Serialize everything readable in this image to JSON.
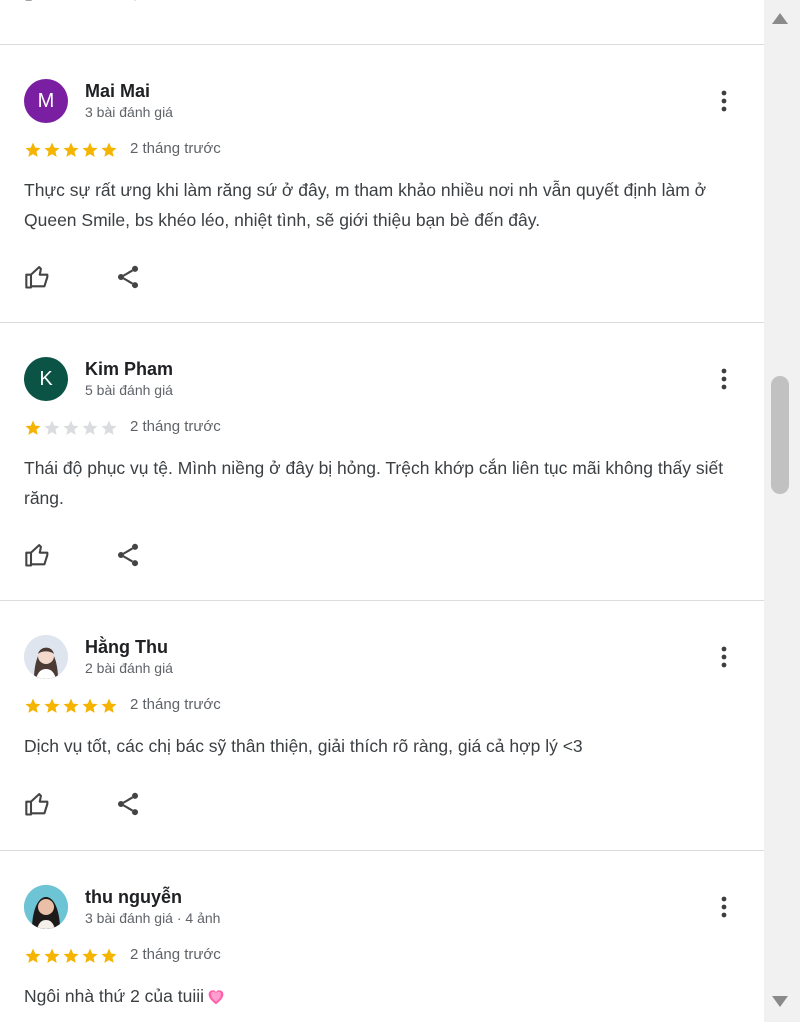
{
  "colors": {
    "star_filled": "#f4b400",
    "star_empty": "#dadce0",
    "divider": "#dadce0"
  },
  "reviews": [
    {
      "initial": "M",
      "avatar_color": "#7b1fa2",
      "name": "Mai Mai",
      "meta": "3 bài đánh giá",
      "rating": 5,
      "time": "2 tháng trước",
      "text": "Thực sự rất ưng khi làm răng sứ ở đây, m tham khảo nhiều nơi nh vẫn quyết định làm ở Queen Smile, bs khéo léo, nhiệt tình, sẽ giới thiệu bạn bè đến đây."
    },
    {
      "initial": "K",
      "avatar_color": "#0b5345",
      "name": "Kim Pham",
      "meta": "5 bài đánh giá",
      "rating": 1,
      "time": "2 tháng trước",
      "text": "Thái độ phục vụ tệ. Mình niềng ở đây bị hỏng. Trệch khớp cắn liên tục mãi không thấy siết răng."
    },
    {
      "initial": "",
      "avatar_color": "#cfd8e3",
      "name": "Hằng Thu",
      "meta": "2 bài đánh giá",
      "rating": 5,
      "time": "2 tháng trước",
      "text": "Dịch vụ tốt, các chị bác sỹ thân thiện, giải thích rõ ràng, giá cả hợp lý <3"
    },
    {
      "initial": "",
      "avatar_color": "#5fb8c9",
      "name": "thu nguyễn",
      "meta": "3 bài đánh giá · 4 ảnh",
      "rating": 5,
      "time": "2 tháng trước",
      "text": "Ngôi nhà thứ 2 của tuiii",
      "emoji": "heart-emoji"
    }
  ]
}
